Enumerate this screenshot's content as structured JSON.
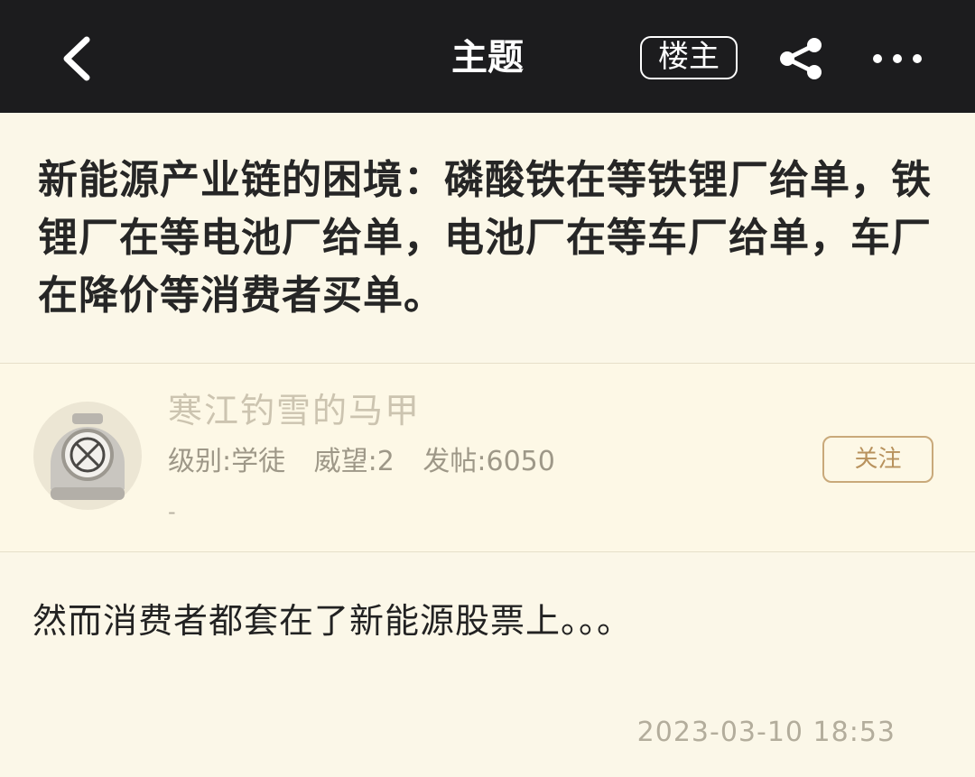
{
  "header": {
    "title": "主题",
    "owner_label": "楼主",
    "icons": {
      "back": "chevron-left-icon",
      "share": "share-icon",
      "more": "more-horizontal-icon"
    }
  },
  "post": {
    "title": "新能源产业链的困境：磷酸铁在等铁锂厂给单，铁锂厂在等电池厂给单，电池厂在等车厂给单，车厂在降价等消费者买单。"
  },
  "author": {
    "name": "寒江钓雪的马甲",
    "level": "级别:学徒",
    "prestige": "威望:2",
    "posts": "发帖:6050",
    "dash": "-",
    "follow_label": "关注"
  },
  "reply": {
    "content": "然而消费者都套在了新能源股票上。。。",
    "timestamp": "2023-03-10 18:53"
  },
  "colors": {
    "topbar_bg": "#1c1c1e",
    "page_bg": "#fbf7e8",
    "follow_accent": "#b8925d"
  }
}
